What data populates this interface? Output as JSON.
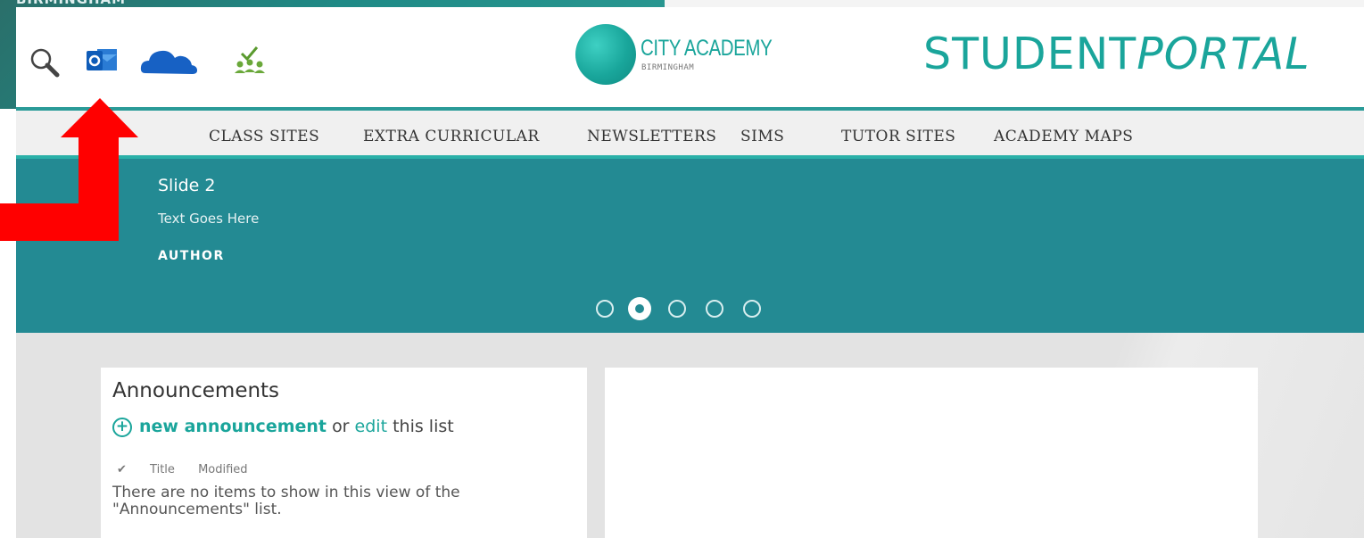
{
  "background": {
    "partial_text": "BIRMINGHAM"
  },
  "header": {
    "icons": [
      "search-icon",
      "outlook-icon",
      "onedrive-icon",
      "people-check-icon"
    ],
    "logo": {
      "name": "CITY ACADEMY",
      "sub": "BIRMINGHAM"
    },
    "portal_a": "STUDENT",
    "portal_b": "PORTAL"
  },
  "nav": {
    "items": [
      "CLASS SITES",
      "EXTRA CURRICULAR",
      "NEWSLETTERS",
      "SIMS",
      "TUTOR SITES",
      "ACADEMY MAPS"
    ]
  },
  "slider": {
    "title": "Slide 2",
    "text": "Text Goes Here",
    "author": "AUTHOR",
    "dots": 5,
    "active_dot": 2
  },
  "announcements": {
    "title": "Announcements",
    "new_link": "new announcement",
    "or": "or",
    "edit_link": "edit",
    "this_list": "this list",
    "col_check": "✔",
    "col_title": "Title",
    "col_modified": "Modified",
    "empty": "There are no items to show in this view of the \"Announcements\" list."
  },
  "colors": {
    "accent": "#1aa59b",
    "slider_bg": "#238a93",
    "arrow": "#ff0000"
  }
}
